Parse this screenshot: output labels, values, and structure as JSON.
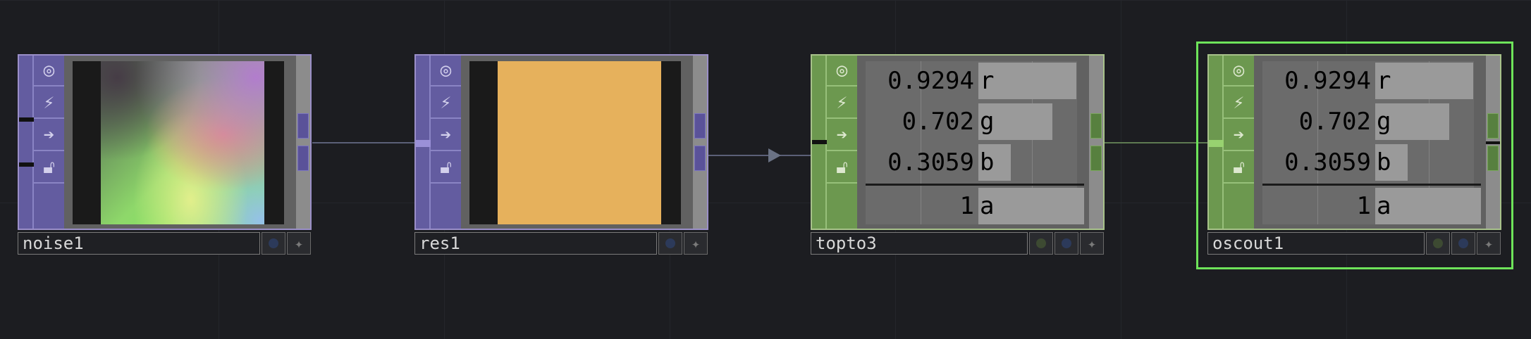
{
  "nodes": [
    {
      "name": "noise1",
      "family": "TOP",
      "viewer": "noise"
    },
    {
      "name": "res1",
      "family": "TOP",
      "viewer": "solid",
      "swatch": "#e6b15c"
    },
    {
      "name": "topto3",
      "family": "CHOP",
      "channels": [
        {
          "value": "0.9294",
          "ch": "r",
          "level": 0.9294
        },
        {
          "value": "0.702",
          "ch": "g",
          "level": 0.702
        },
        {
          "value": "0.3059",
          "ch": "b",
          "level": 0.3059
        },
        {
          "value": "1",
          "ch": "a",
          "level": 1
        }
      ]
    },
    {
      "name": "oscout1",
      "family": "CHOP",
      "selected": true,
      "channels": [
        {
          "value": "0.9294",
          "ch": "r",
          "level": 0.9294
        },
        {
          "value": "0.702",
          "ch": "g",
          "level": 0.702
        },
        {
          "value": "0.3059",
          "ch": "b",
          "level": 0.3059
        },
        {
          "value": "1",
          "ch": "a",
          "level": 1
        }
      ]
    }
  ],
  "icons": [
    "viewer-toggle-icon",
    "cook-icon",
    "bypass-arrow-icon",
    "lock-icon"
  ],
  "colors": {
    "top_family": "#635ca0",
    "chop_family": "#6c984f",
    "selection": "#6ee35a",
    "background": "#1c1d21"
  }
}
